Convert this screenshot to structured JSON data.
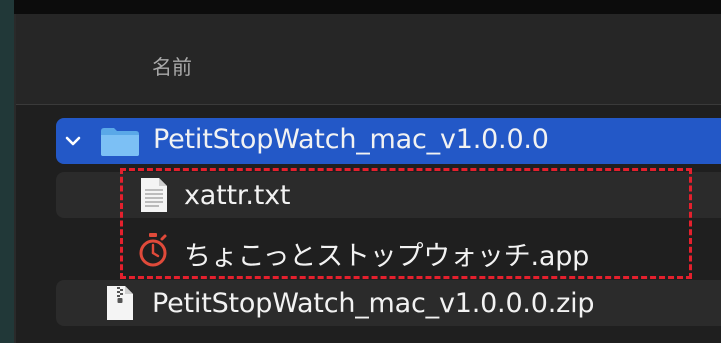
{
  "header": {
    "name_column": "名前"
  },
  "items": [
    {
      "name": "PetitStopWatch_mac_v1.0.0.0",
      "kind": "folder",
      "expanded": true,
      "selected": true
    },
    {
      "name": "xattr.txt",
      "kind": "text-file"
    },
    {
      "name": "ちょこっとストップウォッチ.app",
      "kind": "app"
    },
    {
      "name": "PetitStopWatch_mac_v1.0.0.0.zip",
      "kind": "zip-file"
    }
  ],
  "colors": {
    "selection": "#2358c7",
    "highlight_box": "#e4202d",
    "background": "#1f1f1f"
  }
}
